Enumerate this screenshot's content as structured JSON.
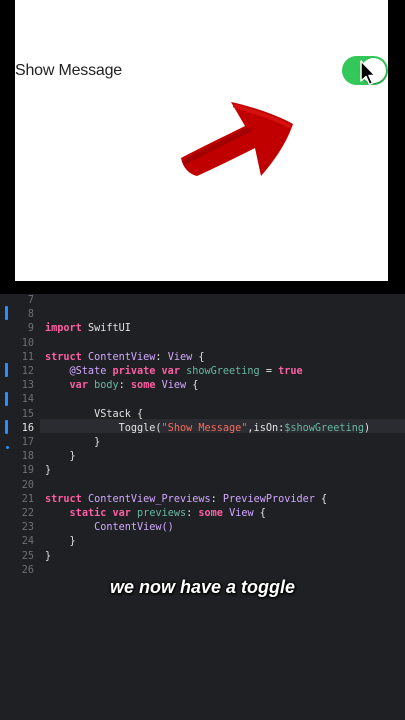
{
  "preview": {
    "toggle_label": "Show Message",
    "toggle_on": true,
    "accent_color": "#34c759",
    "annotation_color": "#c00000"
  },
  "editor": {
    "lines": [
      {
        "num": "7",
        "code": []
      },
      {
        "num": "8",
        "code": []
      },
      {
        "num": "9",
        "code": [
          {
            "t": "import",
            "c": "kw"
          },
          {
            "t": " SwiftUI",
            "c": "pl"
          }
        ]
      },
      {
        "num": "10",
        "code": []
      },
      {
        "num": "11",
        "code": [
          {
            "t": "struct",
            "c": "kw"
          },
          {
            "t": " ",
            "c": "pl"
          },
          {
            "t": "ContentView",
            "c": "ty"
          },
          {
            "t": ": ",
            "c": "pl"
          },
          {
            "t": "View",
            "c": "ty"
          },
          {
            "t": " {",
            "c": "pl"
          }
        ]
      },
      {
        "num": "12",
        "code": [
          {
            "t": "    @State ",
            "c": "ty"
          },
          {
            "t": "private",
            "c": "kw"
          },
          {
            "t": " ",
            "c": "pl"
          },
          {
            "t": "var",
            "c": "kw"
          },
          {
            "t": " ",
            "c": "pl"
          },
          {
            "t": "showGreeting",
            "c": "pr"
          },
          {
            "t": " = ",
            "c": "pl"
          },
          {
            "t": "true",
            "c": "kw"
          }
        ]
      },
      {
        "num": "13",
        "code": [
          {
            "t": "    ",
            "c": "pl"
          },
          {
            "t": "var",
            "c": "kw"
          },
          {
            "t": " ",
            "c": "pl"
          },
          {
            "t": "body",
            "c": "pr"
          },
          {
            "t": ": ",
            "c": "pl"
          },
          {
            "t": "some",
            "c": "kw"
          },
          {
            "t": " ",
            "c": "pl"
          },
          {
            "t": "View",
            "c": "ty"
          },
          {
            "t": " {",
            "c": "pl"
          }
        ]
      },
      {
        "num": "14",
        "code": []
      },
      {
        "num": "15",
        "code": [
          {
            "t": "        VStack {",
            "c": "pl"
          }
        ]
      },
      {
        "num": "16",
        "code": [
          {
            "t": "            Toggle(",
            "c": "pl"
          },
          {
            "t": "\"Show Message\"",
            "c": "st"
          },
          {
            "t": ",isOn:",
            "c": "pl"
          },
          {
            "t": "$showGreeting",
            "c": "pr"
          },
          {
            "t": ")",
            "c": "pl"
          }
        ]
      },
      {
        "num": "17",
        "code": [
          {
            "t": "        }",
            "c": "pl"
          }
        ]
      },
      {
        "num": "18",
        "code": [
          {
            "t": "    }",
            "c": "pl"
          }
        ]
      },
      {
        "num": "19",
        "code": [
          {
            "t": "}",
            "c": "pl"
          }
        ]
      },
      {
        "num": "20",
        "code": []
      },
      {
        "num": "21",
        "code": [
          {
            "t": "struct",
            "c": "kw"
          },
          {
            "t": " ",
            "c": "pl"
          },
          {
            "t": "ContentView_Previews",
            "c": "ty"
          },
          {
            "t": ": ",
            "c": "pl"
          },
          {
            "t": "PreviewProvider",
            "c": "ty"
          },
          {
            "t": " {",
            "c": "pl"
          }
        ]
      },
      {
        "num": "22",
        "code": [
          {
            "t": "    ",
            "c": "pl"
          },
          {
            "t": "static",
            "c": "kw"
          },
          {
            "t": " ",
            "c": "pl"
          },
          {
            "t": "var",
            "c": "kw"
          },
          {
            "t": " ",
            "c": "pl"
          },
          {
            "t": "previews",
            "c": "pr"
          },
          {
            "t": ": ",
            "c": "pl"
          },
          {
            "t": "some",
            "c": "kw"
          },
          {
            "t": " ",
            "c": "pl"
          },
          {
            "t": "View",
            "c": "ty"
          },
          {
            "t": " {",
            "c": "pl"
          }
        ]
      },
      {
        "num": "23",
        "code": [
          {
            "t": "        ContentView()",
            "c": "ty"
          }
        ]
      },
      {
        "num": "24",
        "code": [
          {
            "t": "    }",
            "c": "pl"
          }
        ]
      },
      {
        "num": "25",
        "code": [
          {
            "t": "}",
            "c": "pl"
          }
        ]
      },
      {
        "num": "26",
        "code": []
      }
    ],
    "current_line": "16"
  },
  "caption": "we now have a toggle"
}
